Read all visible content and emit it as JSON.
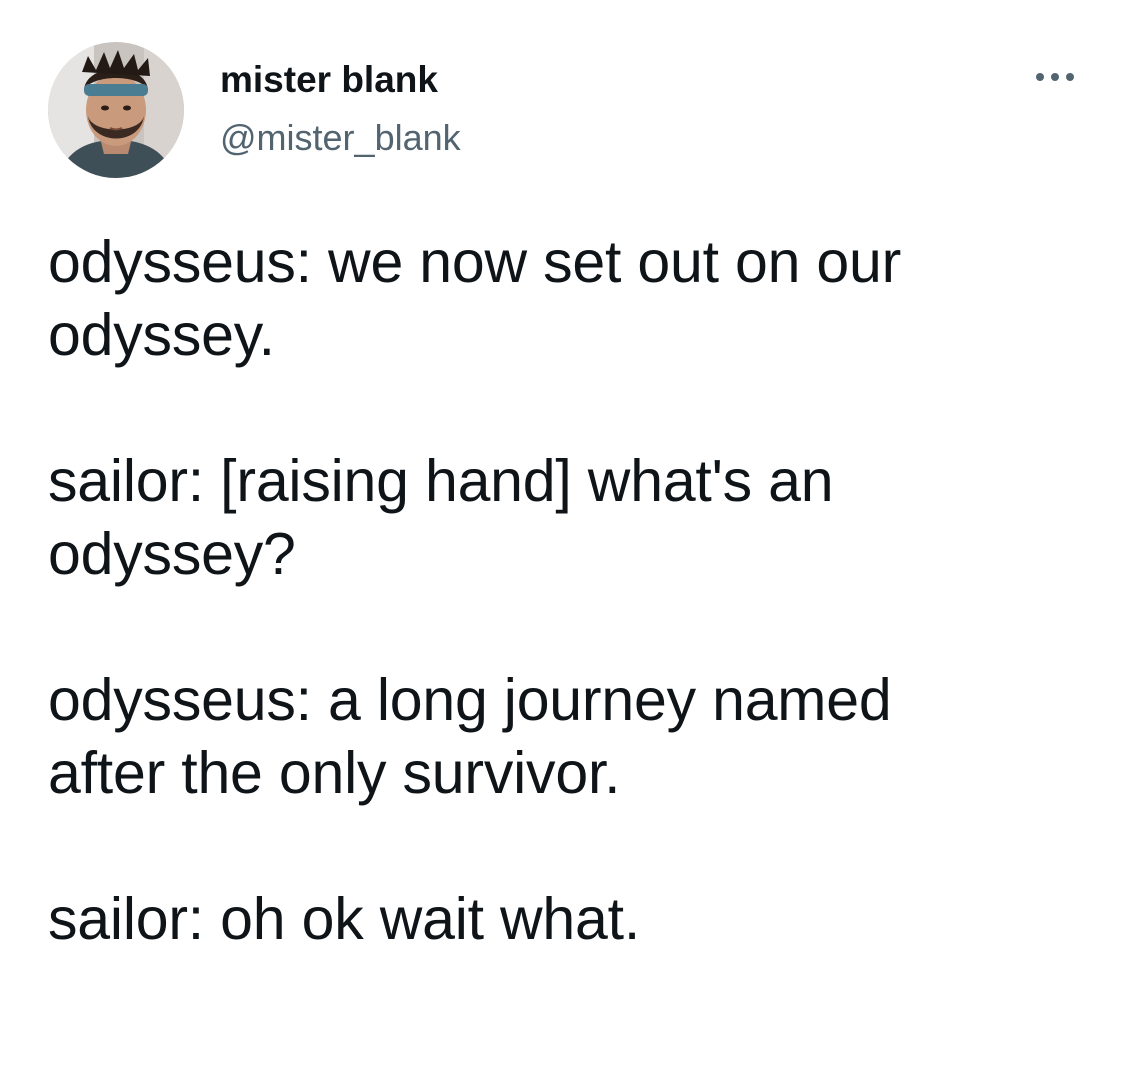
{
  "user": {
    "display_name": "mister blank",
    "handle": "@mister_blank",
    "avatar_icon": "user-avatar-photo"
  },
  "actions": {
    "more_icon": "more-horizontal-icon"
  },
  "tweet": {
    "paragraphs": [
      "odysseus: we now set out on our\nodyssey.",
      "sailor: [raising hand] what's an\nodyssey?",
      "odysseus: a long journey named\nafter the only survivor.",
      "sailor: oh ok wait what."
    ]
  },
  "colors": {
    "text_primary": "#0f1419",
    "text_secondary": "#536471",
    "background": "#ffffff"
  }
}
